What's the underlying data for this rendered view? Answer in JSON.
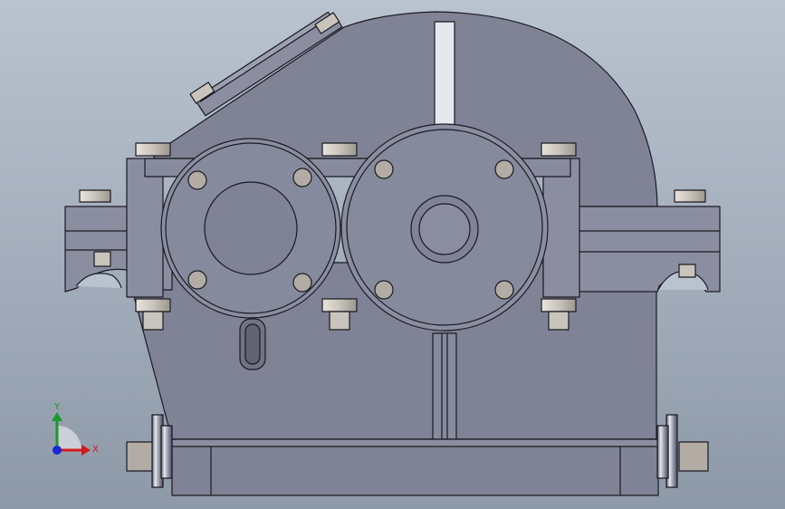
{
  "viewport": {
    "background_top": "#b9c3d0",
    "background_bottom": "#8e99a8",
    "body_color": "#7f8395",
    "body_light": "#8a8ea0",
    "edge_color": "#1a1a22",
    "bolt_color": "#c9c4bc",
    "rib_color": "#e6e8ef"
  },
  "triad": {
    "x_label": "X",
    "y_label": "Y",
    "x_color": "#d11a1a",
    "y_color": "#1a9a2a",
    "z_color": "#1a2ad1"
  }
}
